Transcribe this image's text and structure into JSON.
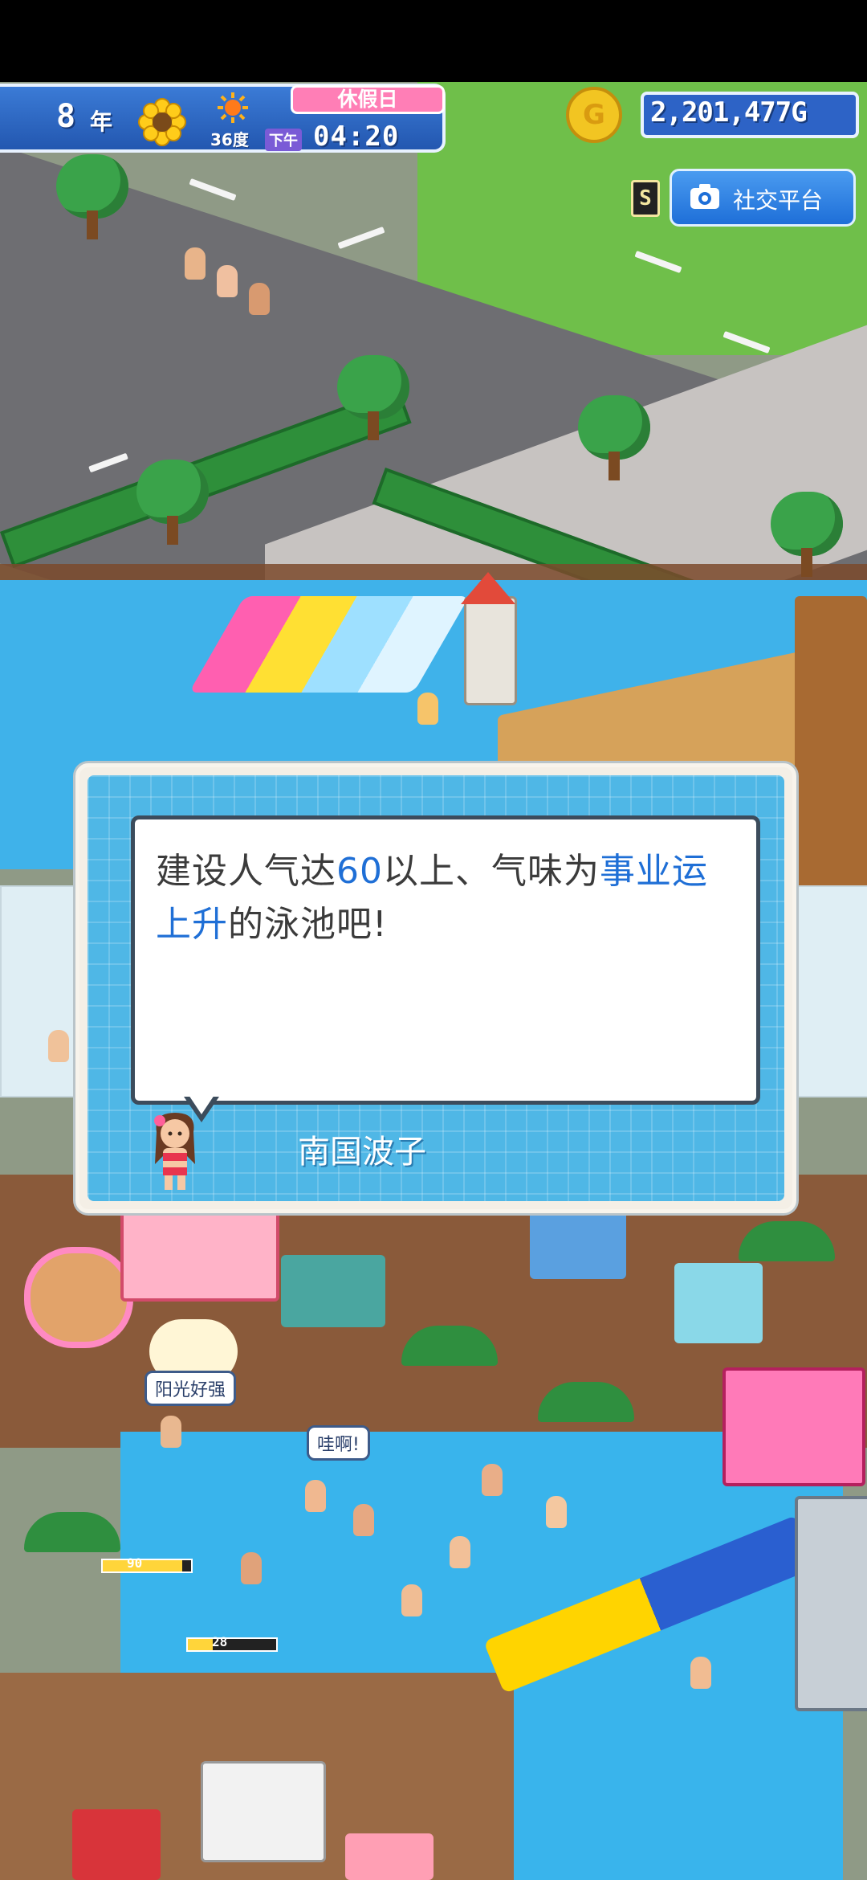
{
  "hud": {
    "year": "8",
    "year_unit": "年",
    "season_icon": "sunflower-icon",
    "weather_icon": "sun-icon",
    "temperature": "36度",
    "day_label": "休假日",
    "ampm": "下午",
    "time": "04:20"
  },
  "money": {
    "coin_symbol": "G",
    "amount": "2,201,477G"
  },
  "social": {
    "badge": "S",
    "icon": "camera-icon",
    "label": "社交平台"
  },
  "dialog": {
    "message_parts": {
      "p1": "建设人气达",
      "p2": "60",
      "p3": "以上、气味为",
      "p4": "事业运上升",
      "p5": "的泳池吧!"
    },
    "speaker": "南国波子",
    "portrait_icon": "girl-portrait-icon"
  },
  "scene": {
    "bubble_sunny": "阳光好强",
    "bubble_wow": "哇啊!",
    "gauge_1": {
      "value": "90"
    },
    "gauge_2": {
      "value": "28"
    }
  }
}
